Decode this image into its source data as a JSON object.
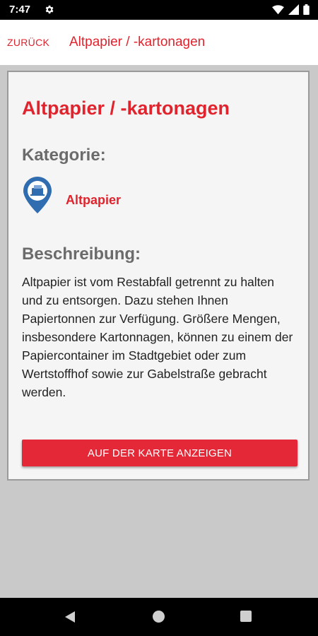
{
  "status_bar": {
    "time": "7:47",
    "icons": [
      "settings-icon",
      "wifi-icon",
      "signal-icon",
      "battery-icon"
    ]
  },
  "app_bar": {
    "back_label": "ZURÜCK",
    "title": "Altpapier / -kartonagen"
  },
  "detail": {
    "title": "Altpapier / -kartonagen",
    "category_heading": "Kategorie:",
    "category_name": "Altpapier",
    "category_icon": "recycling-pin-icon",
    "description_heading": "Beschreibung:",
    "description": "Altpapier ist vom Restabfall getrennt zu halten und zu entsorgen. Dazu stehen Ihnen Papiertonnen zur Verfügung. Größere Mengen, insbesondere Kartonnagen, können zu einem der Papiercontainer im Stadtgebiet oder zum Wertstoffhof sowie zur Gabelstraße gebracht werden.",
    "map_button_label": "AUF DER KARTE ANZEIGEN"
  },
  "colors": {
    "accent": "#e1232d",
    "button": "#e52837",
    "pin_blue": "#2f6db0"
  },
  "nav_bar": {
    "buttons": [
      "back-triangle-icon",
      "home-circle-icon",
      "recents-square-icon"
    ]
  }
}
